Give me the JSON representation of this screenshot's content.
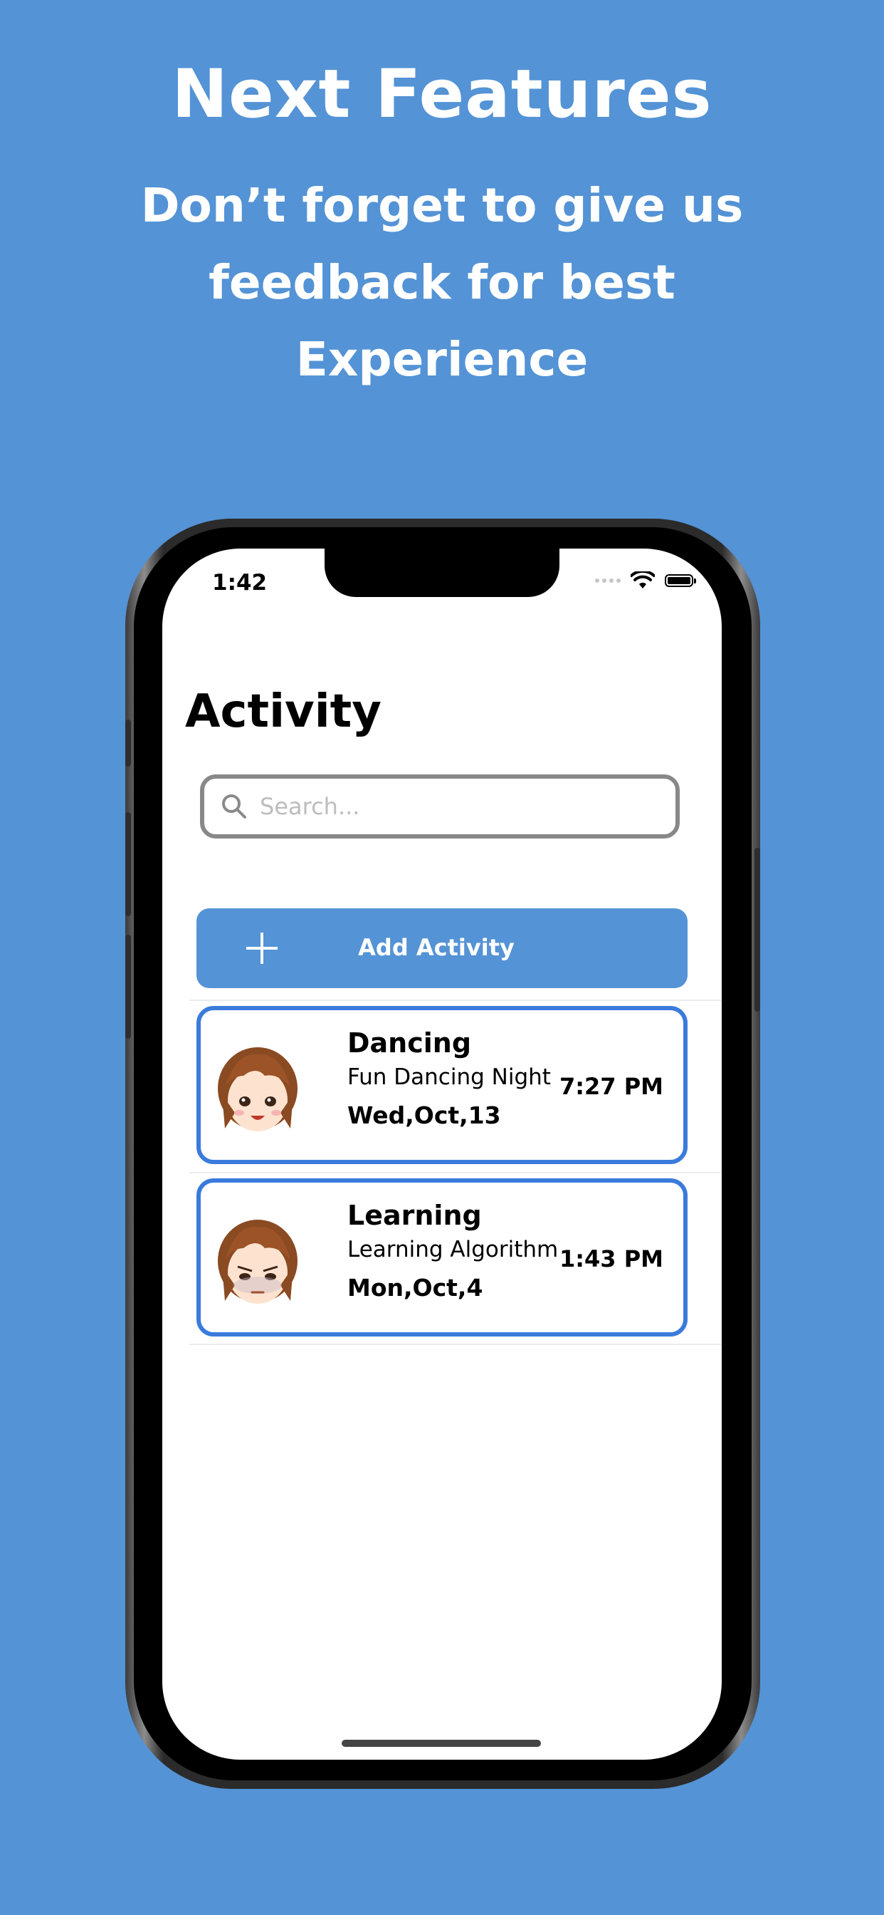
{
  "promo": {
    "headline": "Next Features",
    "subline": "Don’t forget to give us feedback for best Experience"
  },
  "status_bar": {
    "time": "1:42"
  },
  "page": {
    "title": "Activity"
  },
  "search": {
    "placeholder": "Search..."
  },
  "add_button": {
    "label": "Add Activity"
  },
  "activities": [
    {
      "title": "Dancing",
      "subtitle": "Fun Dancing Night",
      "date": "Wed,Oct,13",
      "time": "7:27 PM"
    },
    {
      "title": "Learning",
      "subtitle": "Learning Algorithm",
      "date": "Mon,Oct,4",
      "time": "1:43 PM"
    }
  ],
  "colors": {
    "background": "#5493d5",
    "accent": "#3a7bdc",
    "button": "#5493d5"
  }
}
